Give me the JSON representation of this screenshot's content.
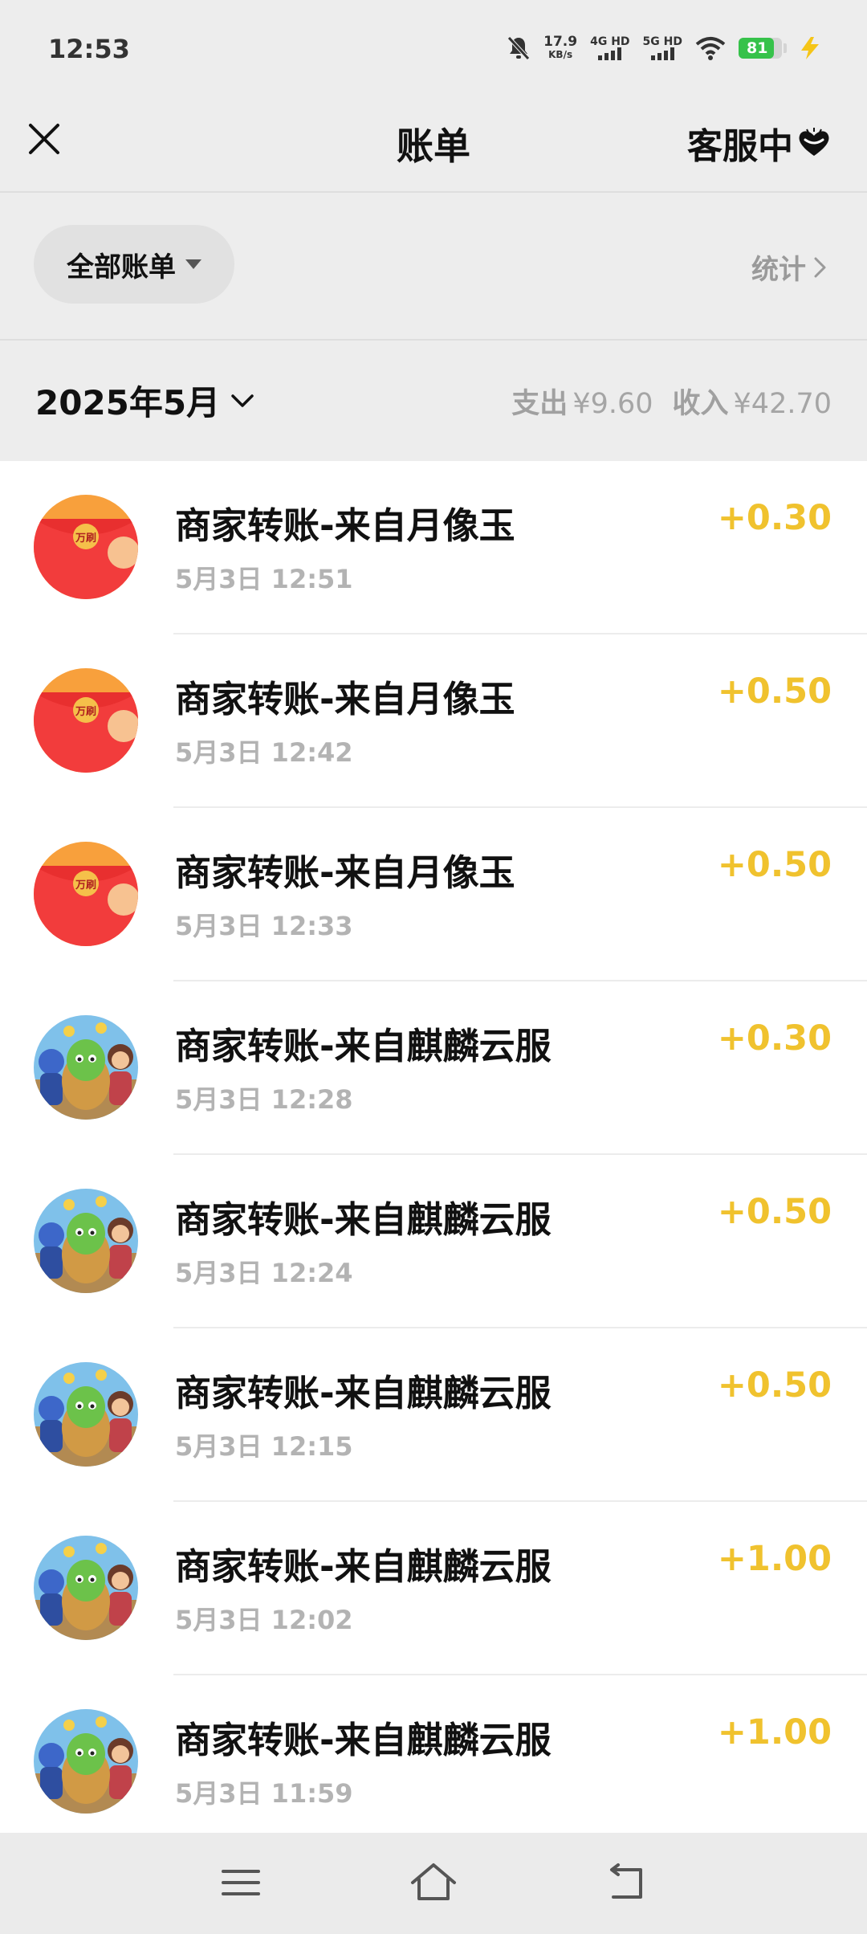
{
  "status_bar": {
    "time": "12:53",
    "net_speed_value": "17.9",
    "net_speed_unit": "KB/s",
    "sim1_label": "4G HD",
    "sim2_label": "5G HD",
    "battery_level": "81",
    "battery_color": "#36c24a"
  },
  "nav": {
    "title": "账单",
    "service_label": "客服中",
    "close_icon": "close-icon",
    "heart_icon": "heart-icon"
  },
  "filter": {
    "all_bills_label": "全部账单",
    "stats_label": "统计"
  },
  "month": {
    "label": "2025年5月",
    "expense_label": "支出",
    "expense_value": "¥9.60",
    "income_label": "收入",
    "income_value": "¥42.70"
  },
  "colors": {
    "amount": "#f0c22e",
    "background": "#ededed"
  },
  "transactions": [
    {
      "title": "商家转账-来自月像玉",
      "time": "5月3日 12:51",
      "amount": "+0.30",
      "avatar": "red-envelope-avatar",
      "avatar_text": "万刷"
    },
    {
      "title": "商家转账-来自月像玉",
      "time": "5月3日 12:42",
      "amount": "+0.50",
      "avatar": "red-envelope-avatar",
      "avatar_text": "万刷"
    },
    {
      "title": "商家转账-来自月像玉",
      "time": "5月3日 12:33",
      "amount": "+0.50",
      "avatar": "red-envelope-avatar",
      "avatar_text": "万刷"
    },
    {
      "title": "商家转账-来自麒麟云服",
      "time": "5月3日 12:28",
      "amount": "+0.30",
      "avatar": "cartoon-characters-avatar"
    },
    {
      "title": "商家转账-来自麒麟云服",
      "time": "5月3日 12:24",
      "amount": "+0.50",
      "avatar": "cartoon-characters-avatar"
    },
    {
      "title": "商家转账-来自麒麟云服",
      "time": "5月3日 12:15",
      "amount": "+0.50",
      "avatar": "cartoon-characters-avatar"
    },
    {
      "title": "商家转账-来自麒麟云服",
      "time": "5月3日 12:02",
      "amount": "+1.00",
      "avatar": "cartoon-characters-avatar"
    },
    {
      "title": "商家转账-来自麒麟云服",
      "time": "5月3日 11:59",
      "amount": "+1.00",
      "avatar": "cartoon-characters-avatar"
    }
  ],
  "system_nav": {
    "menu_icon": "menu-icon",
    "home_icon": "home-icon",
    "back_icon": "back-icon"
  }
}
